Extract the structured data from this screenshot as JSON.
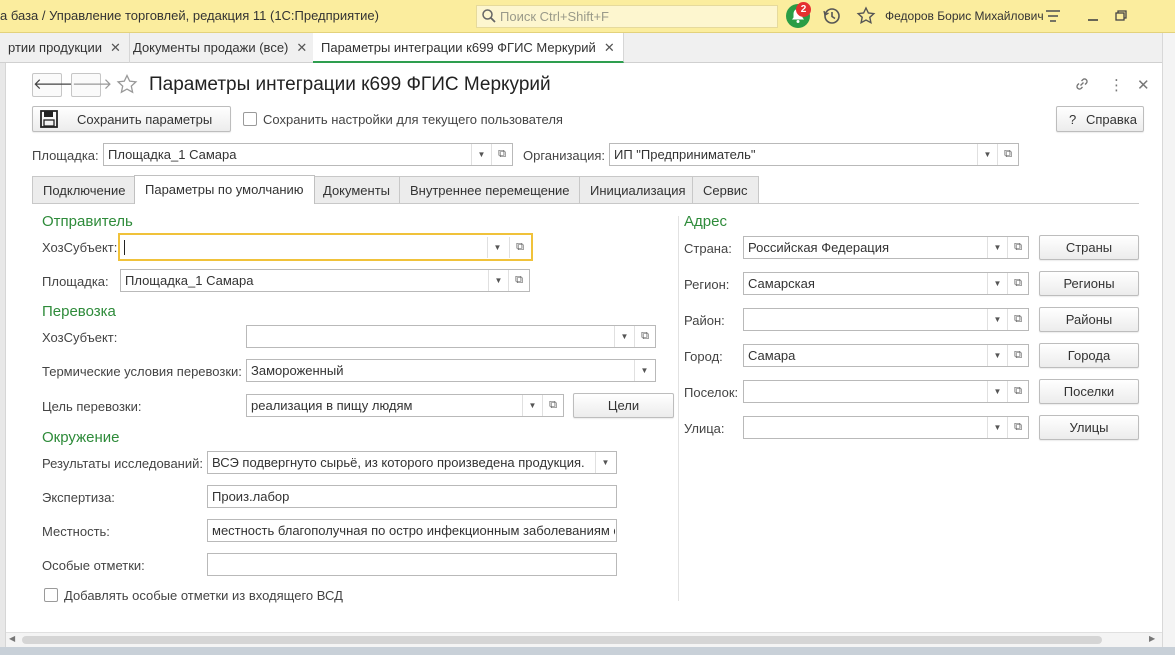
{
  "titlebar": {
    "title": "а база / Управление торговлей, редакция 11  (1С:Предприятие)",
    "search_placeholder": "Поиск Ctrl+Shift+F",
    "notifications_count": "2",
    "user_name": "Федоров Борис Михайлович"
  },
  "open_tabs": [
    {
      "label": "ртии продукции"
    },
    {
      "label": "Документы продажи (все)"
    },
    {
      "label": "Параметры интеграции к699 ФГИС Меркурий",
      "active": true
    }
  ],
  "form": {
    "title": "Параметры интеграции к699 ФГИС Меркурий",
    "save_button": "Сохранить параметры",
    "save_settings_checkbox": "Сохранить настройки для текущего пользователя",
    "help_button": "Справка",
    "ploshchadka_label": "Площадка:",
    "ploshchadka_value": "Площадка_1 Самара",
    "organization_label": "Организация:",
    "organization_value": "ИП \"Предприниматель\""
  },
  "form_tabs": [
    {
      "label": "Подключение"
    },
    {
      "label": "Параметры по умолчанию",
      "active": true
    },
    {
      "label": "Документы"
    },
    {
      "label": "Внутреннее перемещение"
    },
    {
      "label": "Инициализация"
    },
    {
      "label": "Сервис"
    }
  ],
  "sender": {
    "heading": "Отправитель",
    "hoz_label": "ХозСубъект:",
    "hoz_value": "",
    "site_label": "Площадка:",
    "site_value": "Площадка_1 Самара"
  },
  "transport": {
    "heading": "Перевозка",
    "hoz_label": "ХозСубъект:",
    "hoz_value": "",
    "thermal_label": "Термические условия перевозки:",
    "thermal_value": "Замороженный",
    "purpose_label": "Цель перевозки:",
    "purpose_value": "реализация в пищу людям",
    "purpose_button": "Цели"
  },
  "environment": {
    "heading": "Окружение",
    "research_label": "Результаты исследований:",
    "research_value": "ВСЭ подвергнуто сырьё, из которого произведена продукция.",
    "expertise_label": "Экспертиза:",
    "expertise_value": "Произ.лабор",
    "locality_label": "Местность:",
    "locality_value": "местность благополучная по остро инфекционным заболеваниям с",
    "notes_label": "Особые отметки:",
    "notes_value": "",
    "add_notes_checkbox": "Добавлять особые отметки из входящего ВСД"
  },
  "address": {
    "heading": "Адрес",
    "rows": [
      {
        "label": "Страна:",
        "value": "Российская Федерация",
        "button": "Страны"
      },
      {
        "label": "Регион:",
        "value": "Самарская",
        "button": "Регионы"
      },
      {
        "label": "Район:",
        "value": "",
        "button": "Районы"
      },
      {
        "label": "Город:",
        "value": "Самара",
        "button": "Города"
      },
      {
        "label": "Поселок:",
        "value": "",
        "button": "Поселки"
      },
      {
        "label": "Улица:",
        "value": "",
        "button": "Улицы"
      }
    ]
  },
  "colors": {
    "titlebar_bg": "#fbed9e",
    "section_heading": "#2e8b3a",
    "active_tab_underline": "#2e9e4f",
    "focus_border": "#f0c23a",
    "notification_badge": "#e53030"
  }
}
